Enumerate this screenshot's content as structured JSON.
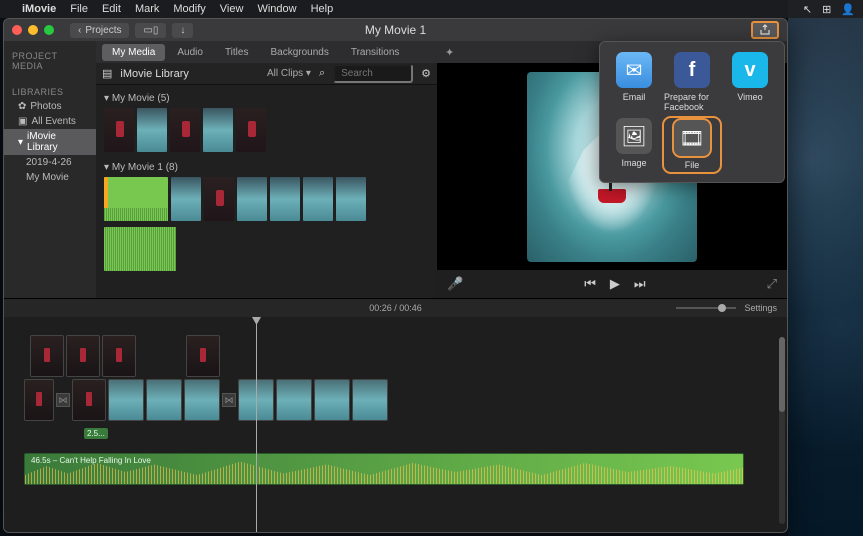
{
  "menubar": {
    "app": "iMovie",
    "items": [
      "File",
      "Edit",
      "Mark",
      "Modify",
      "View",
      "Window",
      "Help"
    ]
  },
  "window": {
    "title": "My Movie 1",
    "projects_btn": "Projects"
  },
  "sidebar": {
    "sec1": "PROJECT MEDIA",
    "sec2": "LIBRARIES",
    "photos": "Photos",
    "allevents": "All Events",
    "imovielib": "iMovie Library",
    "date": "2019-4-26",
    "mymovie": "My Movie"
  },
  "tabs": {
    "mymedia": "My Media",
    "audio": "Audio",
    "titles": "Titles",
    "bg": "Backgrounds",
    "trans": "Transitions"
  },
  "browser": {
    "library": "iMovie Library",
    "allclips": "All Clips",
    "search_ph": "Search",
    "event1": "My Movie  (5)",
    "event2": "My Movie 1  (8)"
  },
  "share": {
    "email": "Email",
    "fb": "Prepare for Facebook",
    "vimeo": "Vimeo",
    "image": "Image",
    "file": "File"
  },
  "timeline": {
    "time": "00:26 / 00:46",
    "settings": "Settings",
    "aud_tag": "2.5...",
    "aud_label": "46.5s – Can't Help Falling In Love"
  }
}
